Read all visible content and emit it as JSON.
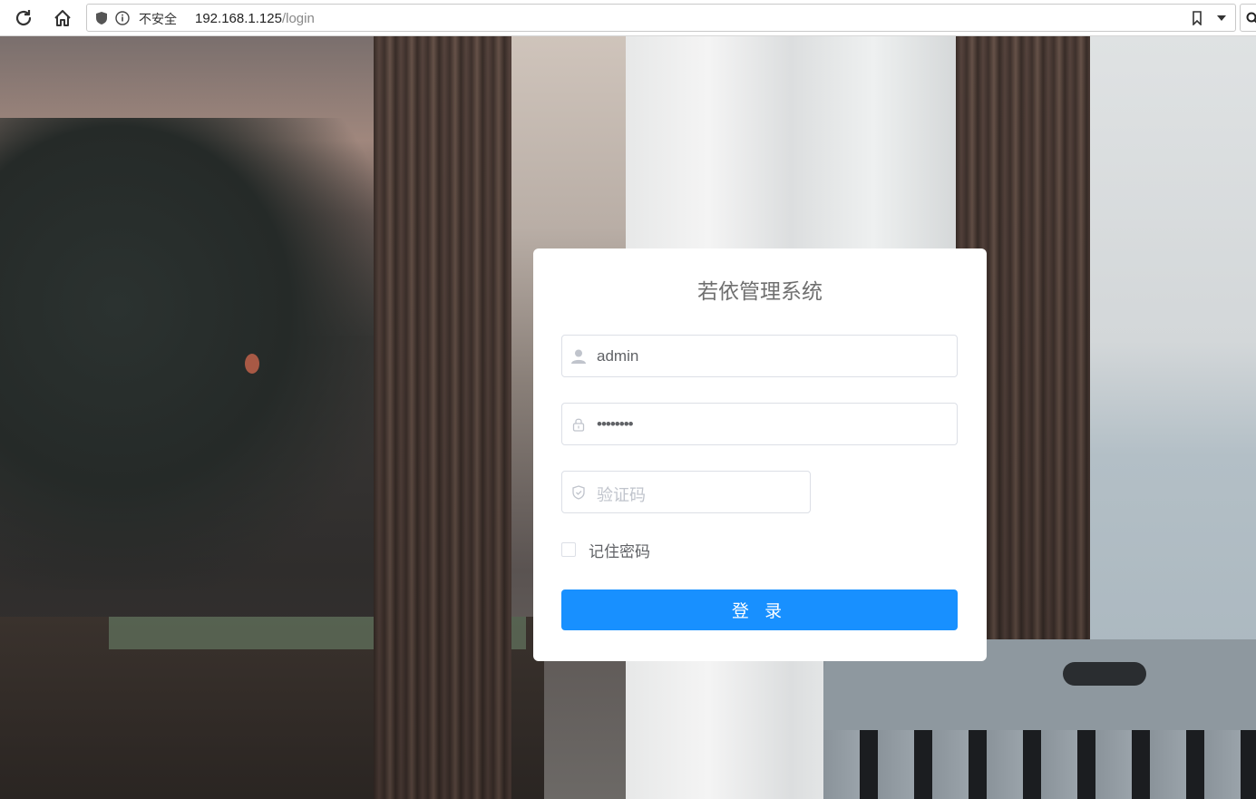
{
  "browser": {
    "security_label": "不安全",
    "url_host": "192.168.1.125",
    "url_path": "/login"
  },
  "login": {
    "title": "若依管理系统",
    "username_value": "admin",
    "password_mask": "••••••••",
    "captcha_placeholder": "验证码",
    "remember_label": "记住密码",
    "remember_checked": false,
    "submit_label": "登 录"
  },
  "colors": {
    "primary": "#1890ff",
    "input_border": "#dcdfe6",
    "placeholder": "#c0c4cc",
    "text": "#606266",
    "title": "#707070"
  },
  "icons": [
    "reload-icon",
    "home-icon",
    "shield-icon",
    "info-icon",
    "bookmark-icon",
    "dropdown-icon",
    "search-icon",
    "user-icon",
    "lock-icon",
    "captcha-shield-icon"
  ]
}
